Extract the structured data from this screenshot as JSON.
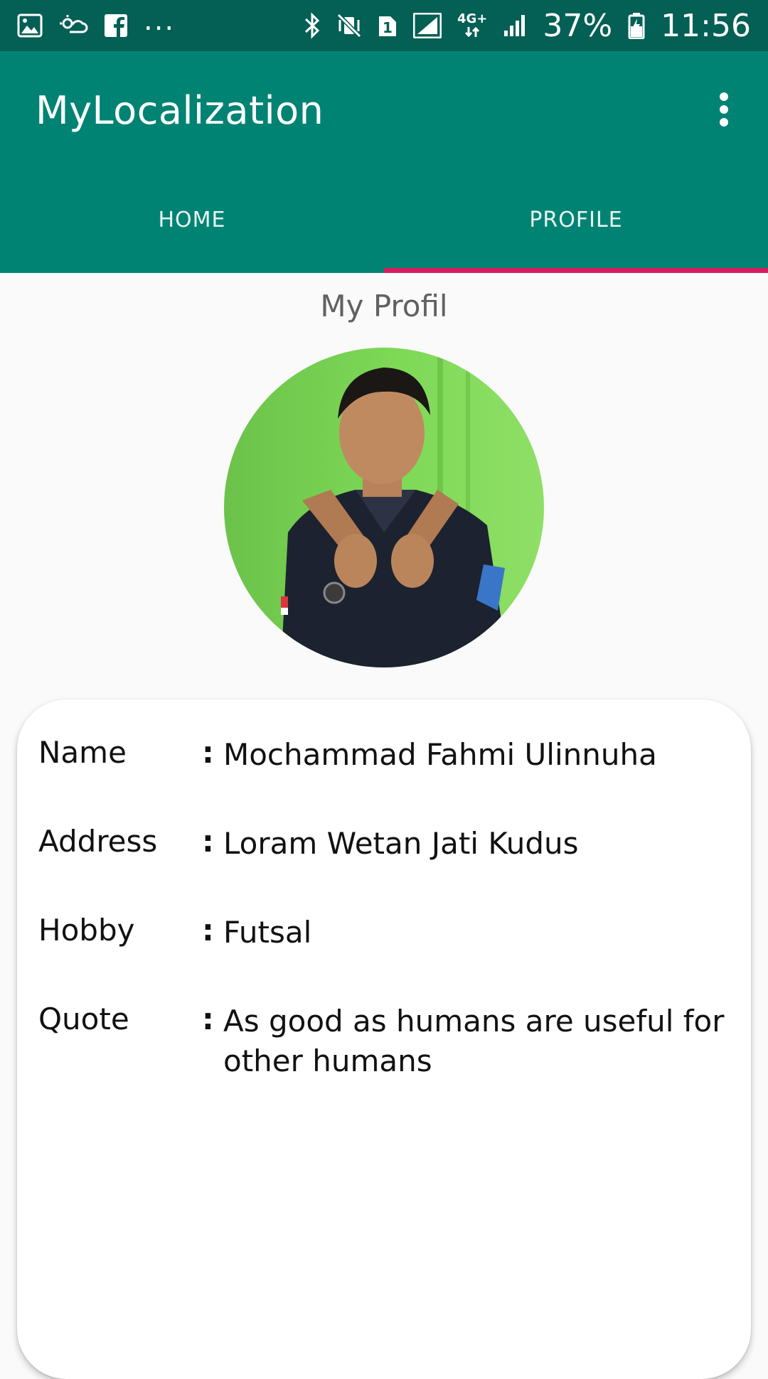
{
  "status_bar": {
    "left_icons": [
      "image-icon",
      "weather-icon",
      "facebook-icon",
      "more-notifications-icon"
    ],
    "more_text": "...",
    "sim_badge": "1",
    "network_type": "4G+",
    "battery_percent": "37%",
    "time": "11:56",
    "right_icons": [
      "bluetooth-icon",
      "vibrate-mute-icon",
      "sim-icon",
      "signal-icon",
      "signal-4g-icon",
      "battery-charging-icon"
    ]
  },
  "app_bar": {
    "title": "MyLocalization",
    "overflow_icon": "more-vert-icon"
  },
  "tabs": [
    {
      "label": "HOME",
      "active": false
    },
    {
      "label": "PROFILE",
      "active": true
    }
  ],
  "profile": {
    "section_title": "My Profil",
    "rows": [
      {
        "label": "Name",
        "value": "Mochammad Fahmi Ulinnuha"
      },
      {
        "label": "Address",
        "value": "Loram Wetan Jati Kudus"
      },
      {
        "label": "Hobby",
        "value": "Futsal"
      },
      {
        "label": "Quote",
        "value": "As good as humans are useful for other humans"
      }
    ]
  },
  "colors": {
    "status_bar": "#045f55",
    "primary": "#018373",
    "tab_indicator": "#d81b60",
    "background": "#fafafa"
  }
}
